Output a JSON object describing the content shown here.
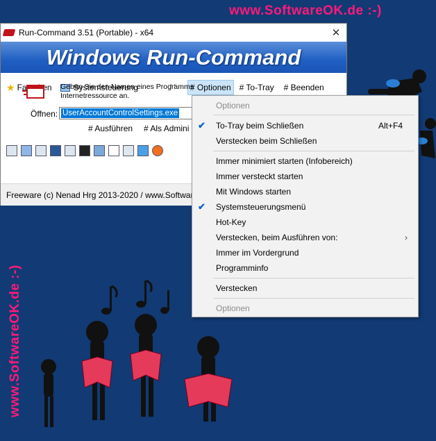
{
  "watermark": {
    "top": "www.SoftwareOK.de :-)",
    "side": "www.SoftwareOK.de :-)",
    "color": "#ff1a7a"
  },
  "window": {
    "title": "Run-Command 3.51 (Portable) - x64",
    "close_label": "✕",
    "banner": "Windows Run-Command",
    "toolbar": {
      "favorites": "Favoriten",
      "control_panel": "Systemsteuerung",
      "dots": "' '",
      "options": "# Optionen",
      "to_tray": "# To-Tray",
      "exit": "# Beenden"
    },
    "prompt_line1": "Geben Sie den Namen eines Programms",
    "prompt_line2": "Internetressource an.",
    "open_label": "Öffnen:",
    "open_value": "UserAccountControlSettings.exe",
    "run_button": "# Ausführen",
    "admin_button": "# Als Admini",
    "status": "Freeware (c) Nenad Hrg 2013-2020 / www.Software"
  },
  "menu": {
    "header": "Optionen",
    "to_tray": "To-Tray beim Schließen",
    "to_tray_shortcut": "Alt+F4",
    "hide_on_close": "Verstecken beim Schließen",
    "start_minimized": "Immer minimiert starten (Infobereich)",
    "start_hidden": "Immer versteckt starten",
    "start_with_windows": "Mit Windows starten",
    "control_panel_menu": "Systemsteuerungsmenü",
    "hotkey": "Hot-Key",
    "hide_when_running": "Verstecken, beim Ausführen von:",
    "always_on_top": "Immer im Vordergrund",
    "program_info": "Programminfo",
    "hide": "Verstecken",
    "footer": "Optionen",
    "check_mark": "✔",
    "submenu_arrow": "›"
  },
  "colors": {
    "background": "#123a74",
    "accent": "#0078d7",
    "banner": "#1f5fc3"
  }
}
